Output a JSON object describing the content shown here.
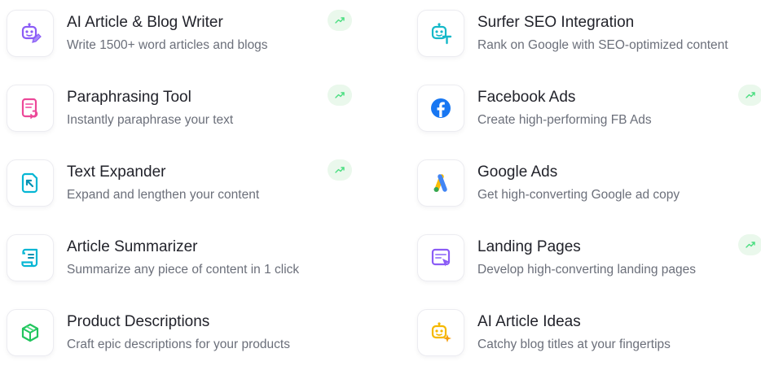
{
  "items": [
    {
      "title": "AI Article & Blog Writer",
      "description": "Write 1500+ word articles and blogs",
      "icon": "robot-pen-icon",
      "icon_color": "#8b5cf6",
      "trending": true
    },
    {
      "title": "Surfer SEO Integration",
      "description": "Rank on Google with SEO-optimized content",
      "icon": "robot-text-icon",
      "icon_color": "#14b8c8",
      "trending": false
    },
    {
      "title": "Paraphrasing Tool",
      "description": "Instantly paraphrase your text",
      "icon": "paraphrase-doc-icon",
      "icon_color": "#ec4899",
      "trending": true
    },
    {
      "title": "Facebook Ads",
      "description": "Create high-performing FB Ads",
      "icon": "facebook-icon",
      "icon_color": "#1877f2",
      "trending": true
    },
    {
      "title": "Text Expander",
      "description": "Expand and lengthen your content",
      "icon": "expand-doc-icon",
      "icon_color": "#06b6d4",
      "trending": true
    },
    {
      "title": "Google Ads",
      "description": "Get high-converting Google ad copy",
      "icon": "google-ads-icon",
      "icon_color": "#4285f4",
      "trending": false
    },
    {
      "title": "Article Summarizer",
      "description": "Summarize any piece of content in 1 click",
      "icon": "scroll-icon",
      "icon_color": "#06b6d4",
      "trending": false
    },
    {
      "title": "Landing Pages",
      "description": "Develop high-converting landing pages",
      "icon": "landing-page-icon",
      "icon_color": "#8b5cf6",
      "trending": true
    },
    {
      "title": "Product Descriptions",
      "description": "Craft epic descriptions for your products",
      "icon": "box-icon",
      "icon_color": "#22c55e",
      "trending": false
    },
    {
      "title": "AI Article Ideas",
      "description": "Catchy blog titles at your fingertips",
      "icon": "robot-idea-icon",
      "icon_color": "#f5b800",
      "trending": false
    }
  ],
  "trend_icon": "trending-up-icon",
  "trend_color": "#4ade80"
}
